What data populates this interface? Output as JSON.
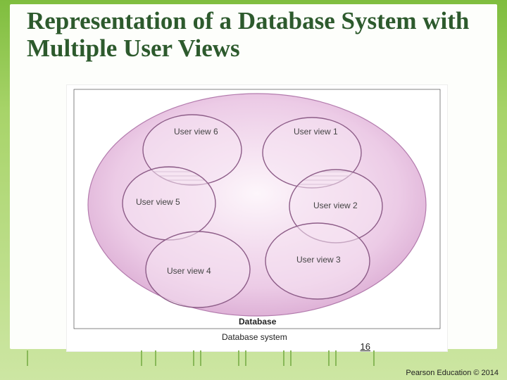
{
  "title": "Representation of a Database System with Multiple User Views",
  "page_number": "16",
  "footer": "Pearson Education © 2014",
  "diagram": {
    "outer_label": "Database system",
    "inner_label": "Database",
    "views": [
      {
        "label": "User view 1"
      },
      {
        "label": "User view 2"
      },
      {
        "label": "User view 3"
      },
      {
        "label": "User view 4"
      },
      {
        "label": "User view 5"
      },
      {
        "label": "User view 6"
      }
    ]
  }
}
